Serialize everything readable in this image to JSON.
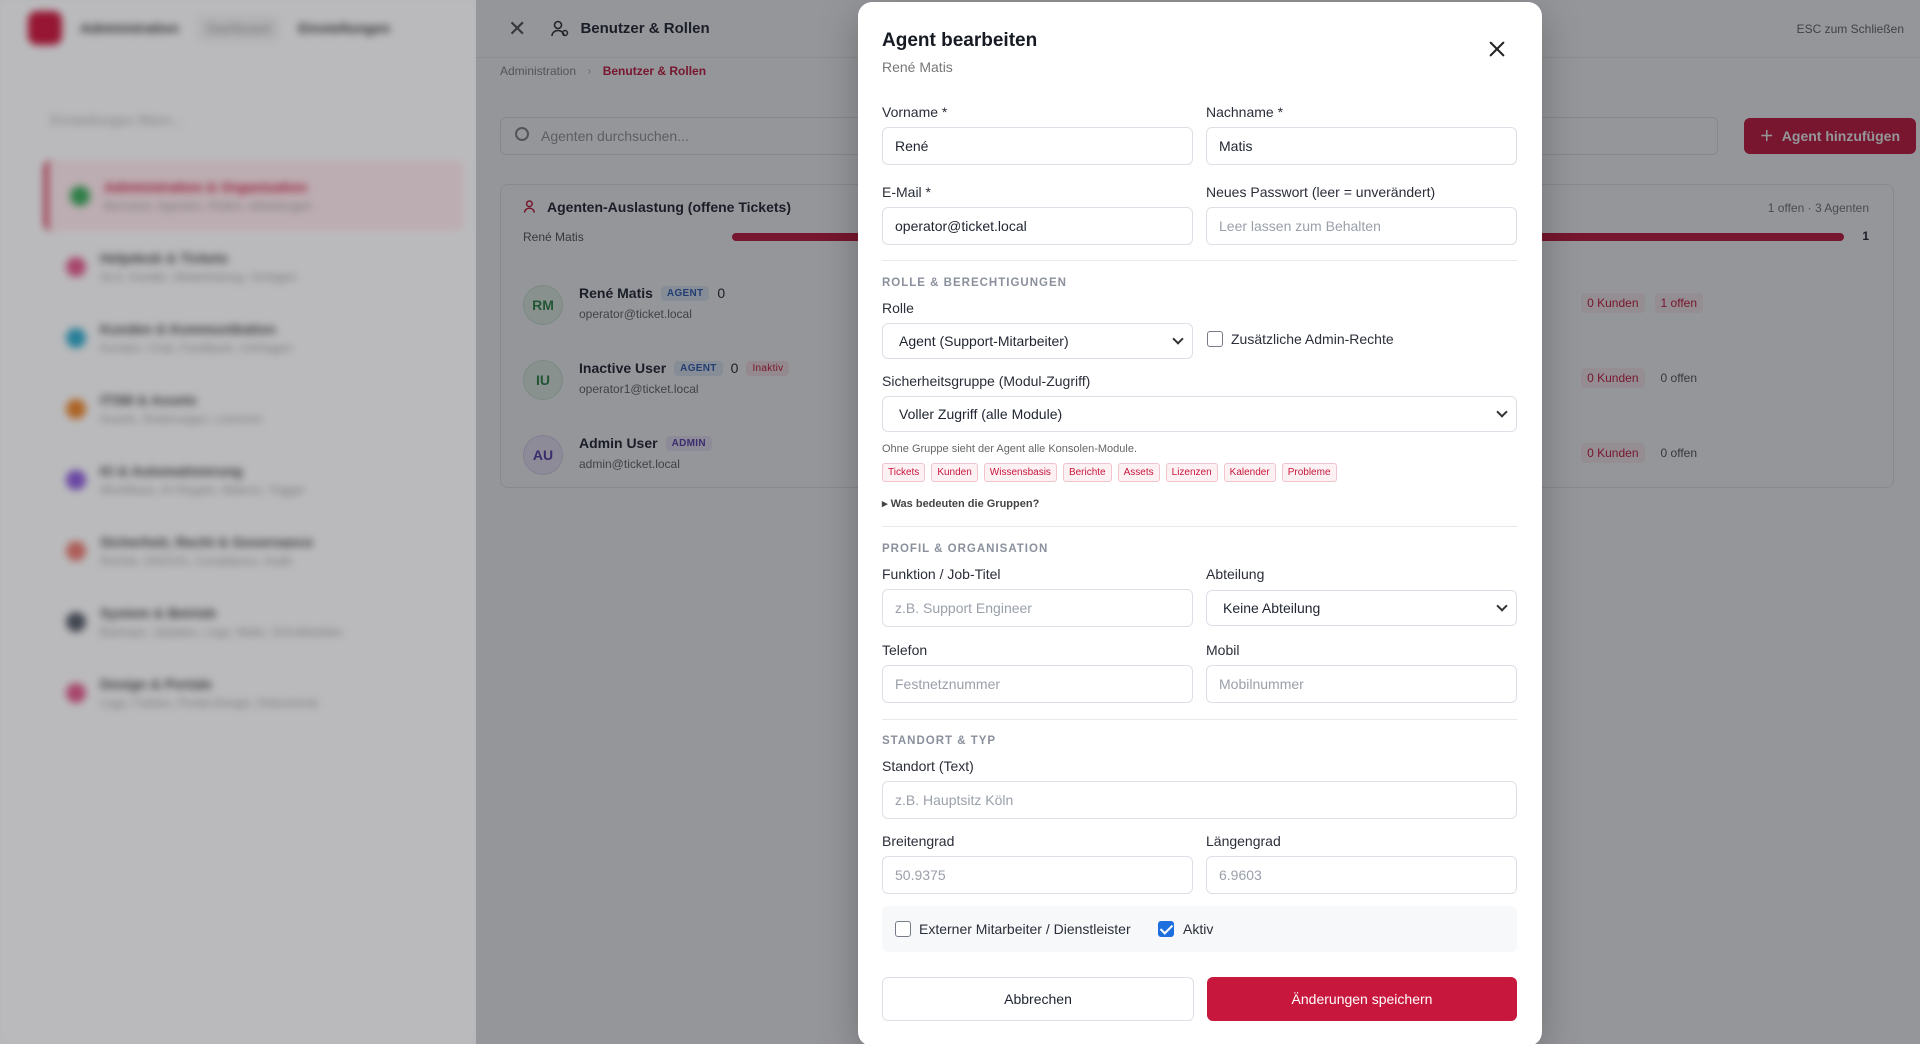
{
  "background": {
    "app_title": "Administration",
    "nav_pill_1": "Dashboard",
    "nav_pill_2": "Einstellungen",
    "search_placeholder": "Einstellungen filtern...",
    "items": [
      {
        "title": "Administration & Organisation",
        "sub": "Benutzer, Agenten, Rollen, Abteilungen"
      },
      {
        "title": "Helpdesk & Tickets",
        "sub": "SLA, Kanäle, Weiterleitung, Vorlagen"
      },
      {
        "title": "Kunden & Kommunikation",
        "sub": "Kunden, Chat, Feedback, Umfragen"
      },
      {
        "title": "ITSM & Assets",
        "sub": "Assets, Änderungen, Lizenzen"
      },
      {
        "title": "KI & Automatisierung",
        "sub": "Workflows, KI-Regeln, Makros, Trigger"
      },
      {
        "title": "Sicherheit, Recht & Governance",
        "sub": "Rechte, DSGVO, Compliance, Audit"
      },
      {
        "title": "System & Betrieb",
        "sub": "Backups, Updates, Logs, Mails, Schnittstellen"
      },
      {
        "title": "Design & Portale",
        "sub": "Logo, Farben, Portal-Design, Dokumente"
      }
    ]
  },
  "panel": {
    "title": "Benutzer & Rollen",
    "esc_hint": "ESC zum Schließen",
    "breadcrumb_root": "Administration",
    "breadcrumb_current": "Benutzer & Rollen",
    "search_placeholder": "Agenten durchsuchen...",
    "add_button": "Agent hinzufügen",
    "workload_title": "Agenten-Auslastung (offene Tickets)",
    "workload_summary": "1 offen · 3 Agenten",
    "workload_bar_label": "René Matis",
    "workload_bar_value": "1",
    "users": [
      {
        "initials": "RM",
        "name": "René Matis",
        "role": "AGENT",
        "count": "0",
        "email": "operator@ticket.local",
        "inactive": "",
        "customers": "0 Kunden",
        "open": "1 offen"
      },
      {
        "initials": "IU",
        "name": "Inactive User",
        "role": "AGENT",
        "count": "0",
        "email": "operator1@ticket.local",
        "inactive": "Inaktiv",
        "customers": "0 Kunden",
        "open": "0 offen"
      },
      {
        "initials": "AU",
        "name": "Admin User",
        "role": "ADMIN",
        "count": "",
        "email": "admin@ticket.local",
        "inactive": "",
        "customers": "0 Kunden",
        "open": "0 offen"
      }
    ]
  },
  "modal": {
    "title": "Agent bearbeiten",
    "subtitle": "René Matis",
    "firstname_label": "Vorname *",
    "firstname_value": "René",
    "lastname_label": "Nachname *",
    "lastname_value": "Matis",
    "email_label": "E-Mail *",
    "email_value": "operator@ticket.local",
    "password_label": "Neues Passwort (leer = unverändert)",
    "password_placeholder": "Leer lassen zum Behalten",
    "section_roles": "ROLLE & BERECHTIGUNGEN",
    "role_label": "Rolle",
    "role_value": "Agent (Support-Mitarbeiter)",
    "admin_rights_label": "Zusätzliche Admin-Rechte",
    "group_label": "Sicherheitsgruppe (Modul-Zugriff)",
    "group_value": "Voller Zugriff (alle Module)",
    "group_hint": "Ohne Gruppe sieht der Agent alle Konsolen-Module.",
    "modules": [
      "Tickets",
      "Kunden",
      "Wissensbasis",
      "Berichte",
      "Assets",
      "Lizenzen",
      "Kalender",
      "Probleme"
    ],
    "groups_details": "▸ Was bedeuten die Gruppen?",
    "section_profile": "PROFIL & ORGANISATION",
    "jobtitle_label": "Funktion / Job-Titel",
    "jobtitle_placeholder": "z.B. Support Engineer",
    "department_label": "Abteilung",
    "department_value": "Keine Abteilung",
    "phone_label": "Telefon",
    "phone_placeholder": "Festnetznummer",
    "mobile_label": "Mobil",
    "mobile_placeholder": "Mobilnummer",
    "section_location": "STANDORT & TYP",
    "location_label": "Standort (Text)",
    "location_placeholder": "z.B. Hauptsitz Köln",
    "lat_label": "Breitengrad",
    "lat_placeholder": "50.9375",
    "lng_label": "Längengrad",
    "lng_placeholder": "6.9603",
    "external_label": "Externer Mitarbeiter / Dienstleister",
    "external_checked": false,
    "active_label": "Aktiv",
    "active_checked": true,
    "cancel_button": "Abbrechen",
    "save_button": "Änderungen speichern"
  },
  "colors": {
    "accent": "#c8173c",
    "checkbox": "#1d6fe0"
  }
}
